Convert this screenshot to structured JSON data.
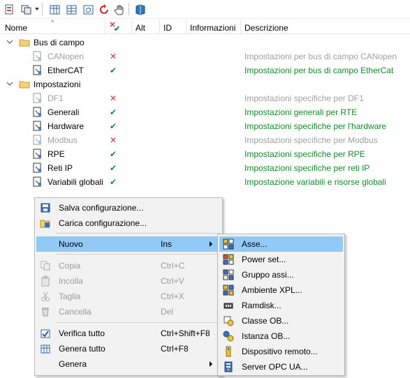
{
  "toolbar": {
    "buttons": [
      "settings-icon",
      "copy-layout-icon",
      "grid-a-icon",
      "grid-b-icon",
      "sync-icon",
      "refresh-icon",
      "hand-icon",
      "book-icon"
    ]
  },
  "table": {
    "headers": {
      "name": "Nome",
      "alt": "Alt",
      "id": "ID",
      "info": "Informazioni",
      "desc": "Descrizione"
    },
    "groups": [
      {
        "label": "Bus di campo",
        "items": [
          {
            "name": "CANopen",
            "status": "✕",
            "enabled": false,
            "desc": "Impostazioni per bus di campo CANopen"
          },
          {
            "name": "EtherCAT",
            "status": "✔",
            "enabled": true,
            "desc": "Impostazioni per bus di campo EtherCat"
          }
        ]
      },
      {
        "label": "Impostazioni",
        "items": [
          {
            "name": "DF1",
            "status": "✕",
            "enabled": false,
            "desc": "Impostazioni specifiche per DF1"
          },
          {
            "name": "Generali",
            "status": "✔",
            "enabled": true,
            "desc": "Impostazioni generali per RTE"
          },
          {
            "name": "Hardware",
            "status": "✔",
            "enabled": true,
            "desc": "Impostazioni specifiche per l'hardware"
          },
          {
            "name": "Modbus",
            "status": "✕",
            "enabled": false,
            "desc": "Impostazioni specifiche per Modbus"
          },
          {
            "name": "RPE",
            "status": "✔",
            "enabled": true,
            "desc": "Impostazioni specifiche per RPE"
          },
          {
            "name": "Reti IP",
            "status": "✔",
            "enabled": true,
            "desc": "Impostazioni specifiche per reti IP"
          },
          {
            "name": "Variabili globali",
            "status": "✔",
            "enabled": true,
            "desc": "Impostazione variabili e risorse globali"
          }
        ]
      }
    ]
  },
  "context_menu": {
    "items": [
      {
        "label": "Salva configurazione...",
        "shortcut": "",
        "disabled": false,
        "icon": "save-config-icon"
      },
      {
        "label": "Carica configurazione...",
        "shortcut": "",
        "disabled": false,
        "icon": "load-config-icon"
      },
      {
        "label": "Nuovo",
        "shortcut": "Ins",
        "disabled": false,
        "submenu": true,
        "highlighted": true
      },
      {
        "label": "Copia",
        "shortcut": "Ctrl+C",
        "disabled": true,
        "icon": "copy-icon"
      },
      {
        "label": "Incolla",
        "shortcut": "Ctrl+V",
        "disabled": true,
        "icon": "paste-icon"
      },
      {
        "label": "Taglia",
        "shortcut": "Ctrl+X",
        "disabled": true,
        "icon": "cut-icon"
      },
      {
        "label": "Cancella",
        "shortcut": "Del",
        "disabled": true,
        "icon": "delete-icon"
      },
      {
        "label": "Verifica tutto",
        "shortcut": "Ctrl+Shift+F8",
        "disabled": false,
        "icon": "verify-icon"
      },
      {
        "label": "Genera tutto",
        "shortcut": "Ctrl+F8",
        "disabled": false,
        "icon": "generate-icon"
      },
      {
        "label": "Genera",
        "shortcut": "",
        "disabled": false,
        "submenu": true
      }
    ]
  },
  "submenu": {
    "items": [
      {
        "label": "Asse...",
        "icon": "axis-icon",
        "highlighted": true
      },
      {
        "label": "Power set...",
        "icon": "power-set-icon"
      },
      {
        "label": "Gruppo assi...",
        "icon": "axis-group-icon"
      },
      {
        "label": "Ambiente XPL...",
        "icon": "xpl-icon"
      },
      {
        "label": "Ramdisk...",
        "icon": "ramdisk-icon"
      },
      {
        "label": "Classe OB...",
        "icon": "class-ob-icon"
      },
      {
        "label": "Istanza OB...",
        "icon": "instance-ob-icon"
      },
      {
        "label": "Dispositivo remoto...",
        "icon": "remote-device-icon"
      },
      {
        "label": "Server OPC UA...",
        "icon": "opc-ua-icon"
      }
    ]
  },
  "colors": {
    "highlight": "#91c9f7",
    "enabled_text": "#168a2a",
    "disabled_text": "#a0a0a0",
    "error_mark": "#e03030"
  }
}
